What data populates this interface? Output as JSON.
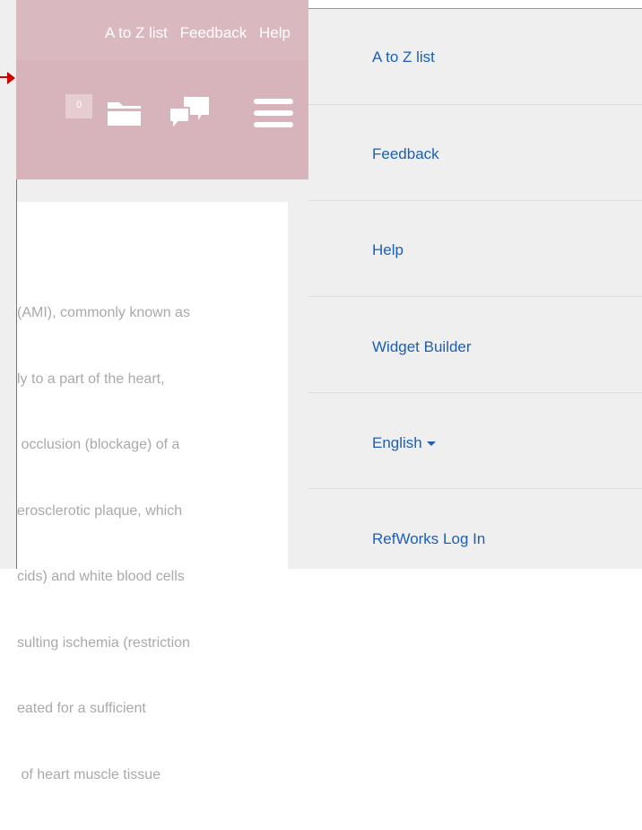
{
  "top_links": [
    "A to Z list",
    "Feedback",
    "Help"
  ],
  "header": {
    "badge_count": "0"
  },
  "content": {
    "lines": [
      "(AMI), commonly known as",
      "ly to a part of the heart,",
      " occlusion (blockage) of a",
      "erosclerotic plaque, which",
      "cids) and white blood cells",
      "sulting ischemia (restriction",
      "eated for a sufficient",
      " of heart muscle tissue"
    ]
  },
  "menu": {
    "items": [
      {
        "label": "A to Z list"
      },
      {
        "label": "Feedback"
      },
      {
        "label": "Help"
      },
      {
        "label": "Widget Builder"
      },
      {
        "label": "English"
      },
      {
        "label": "RefWorks Log In"
      }
    ]
  },
  "colors": {
    "header_bg": "#d7b3bb",
    "link": "#1c5fb4",
    "arrow": "#cc0000"
  },
  "icons": [
    "folder-icon",
    "chat-icon",
    "hamburger-menu-icon",
    "red-arrow-icon"
  ]
}
